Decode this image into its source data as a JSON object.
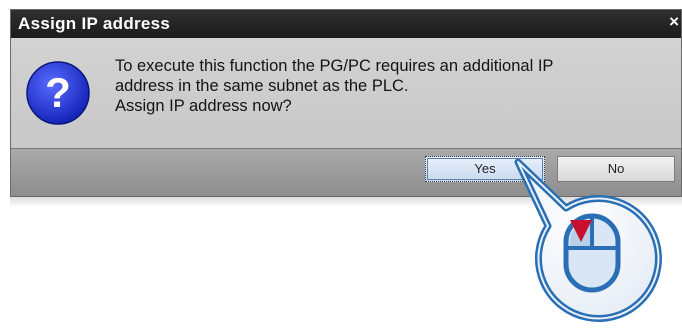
{
  "dialog": {
    "title": "Assign IP address",
    "close_glyph": "×",
    "icon": "question-icon",
    "icon_glyph": "?",
    "message_lines": [
      "To execute this function the PG/PC requires an additional IP",
      "address in the same subnet as the PLC.",
      "Assign IP address now?"
    ],
    "buttons": {
      "yes": "Yes",
      "no": "No"
    }
  },
  "callout": {
    "icon": "mouse-left-click-icon"
  },
  "colors": {
    "titlebar": "#1c1c1c",
    "icon_blue": "#1c2fd0",
    "callout_blue": "#2a6fb5",
    "click_red": "#c8102e"
  }
}
